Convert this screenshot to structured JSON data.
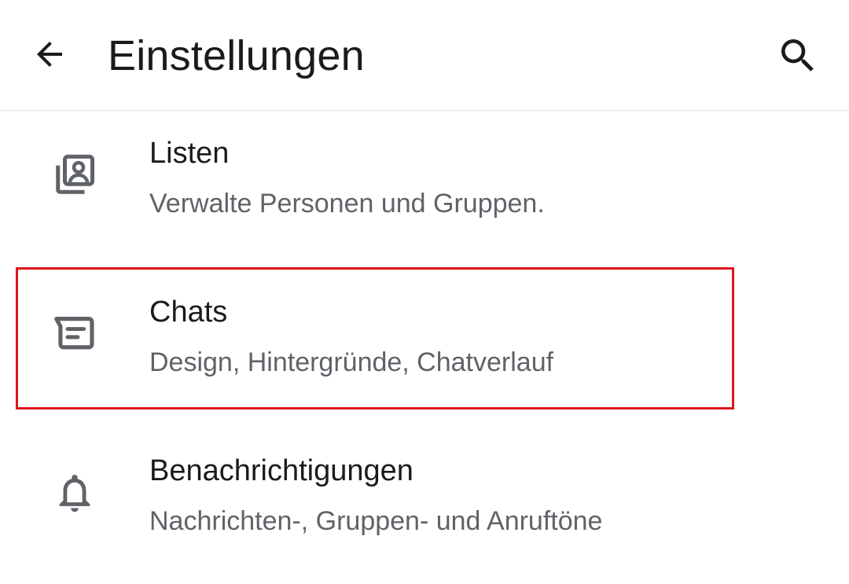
{
  "header": {
    "title": "Einstellungen",
    "back_icon": "arrow-left-icon",
    "search_icon": "search-icon"
  },
  "settings": [
    {
      "icon": "contact-lists-icon",
      "title": "Listen",
      "subtitle": "Verwalte Personen und Gruppen."
    },
    {
      "icon": "chat-icon",
      "title": "Chats",
      "subtitle": "Design, Hintergründe, Chatverlauf",
      "highlighted": true
    },
    {
      "icon": "bell-icon",
      "title": "Benachrichtigungen",
      "subtitle": "Nachrichten-, Gruppen- und Anruftöne"
    }
  ],
  "colors": {
    "highlight": "#e0141e",
    "title_text": "#1b1b1b",
    "subtitle_text": "#5f6368",
    "icon": "#5f6368"
  }
}
